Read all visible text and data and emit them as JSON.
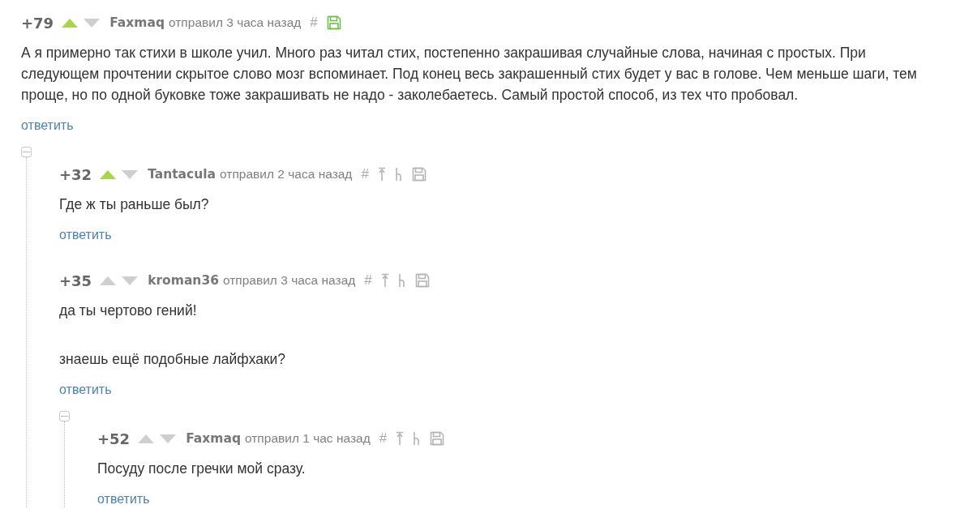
{
  "comments": [
    {
      "score": "+79",
      "upvoted": true,
      "downvoted": false,
      "author": "Faxmaq",
      "meta": "отправил 3 часа назад",
      "hash": "#",
      "saved": true,
      "nav_links": false,
      "body": [
        "А я примерно так стихи в школе учил. Много раз читал стих, постепенно закрашивая случайные слова, начиная с простых. При следующем прочтении скрытое слово мозг вспоминает. Под конец весь закрашенный стих будет у вас в голове. Чем меньше шаги, тем проще, но по одной буковке тоже закрашивать не надо - заколебаетесь. Самый простой способ, из тех что пробовал."
      ],
      "reply": "ответить",
      "expanded": true,
      "children": [
        {
          "score": "+32",
          "upvoted": true,
          "downvoted": false,
          "author": "Tantacula",
          "meta": "отправил 2 часа назад",
          "hash": "#",
          "saved": false,
          "nav_links": true,
          "body": [
            "Где ж ты раньше был?"
          ],
          "reply": "ответить"
        },
        {
          "score": "+35",
          "upvoted": false,
          "downvoted": false,
          "author": "kroman36",
          "meta": "отправил 3 часа назад",
          "hash": "#",
          "saved": false,
          "nav_links": true,
          "body": [
            "да ты чертово гений!",
            "знаешь ещё подобные лайфхаки?"
          ],
          "reply": "ответить",
          "expanded": true,
          "children": [
            {
              "score": "+52",
              "upvoted": false,
              "downvoted": false,
              "author": "Faxmaq",
              "meta": "отправил 1 час назад",
              "hash": "#",
              "saved": false,
              "nav_links": true,
              "body": [
                "Посуду после гречки мой сразу."
              ],
              "reply": "ответить"
            }
          ]
        }
      ]
    }
  ]
}
